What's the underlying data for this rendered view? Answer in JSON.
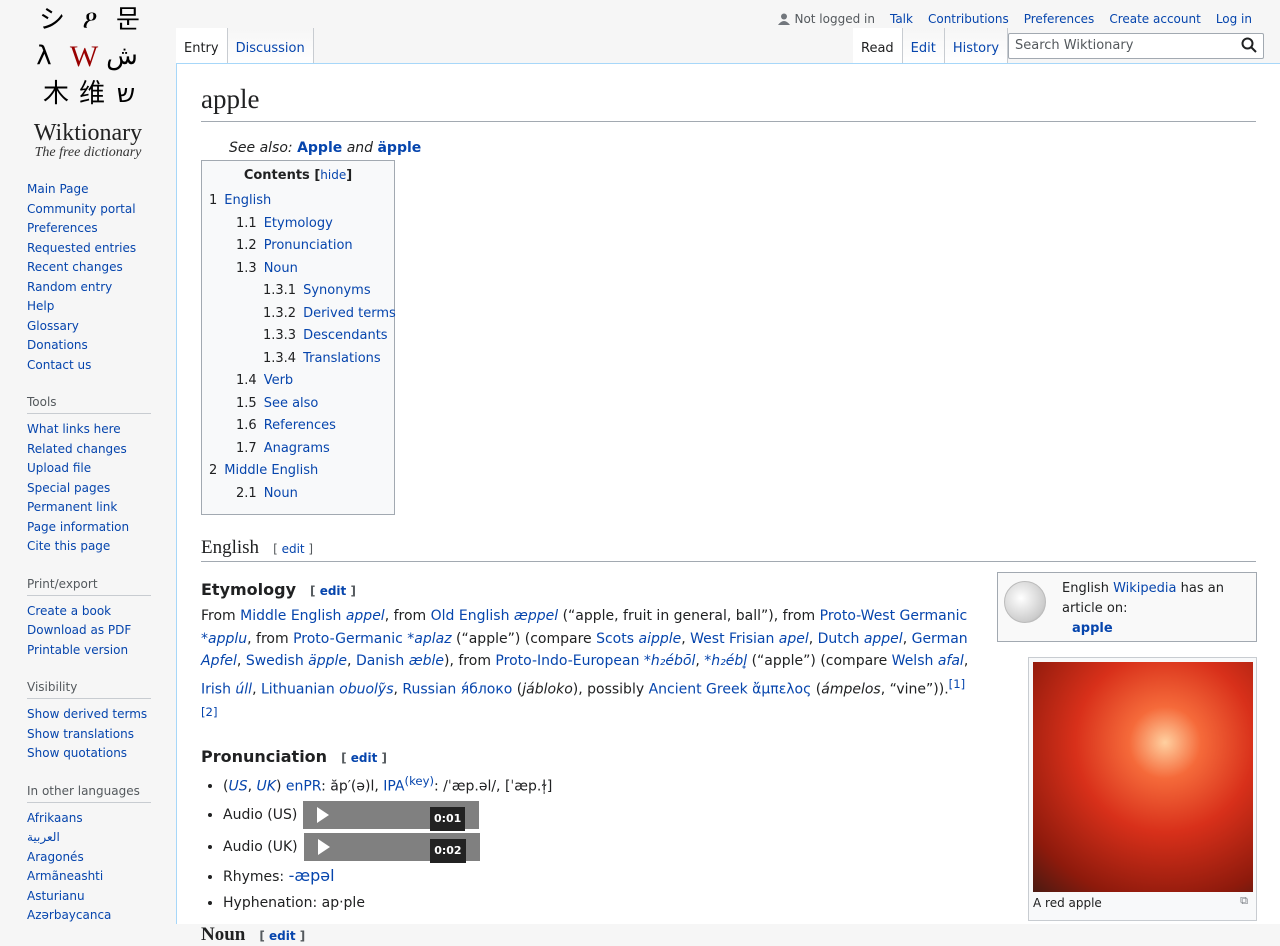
{
  "site": {
    "name": "Wiktionary",
    "tagline": "The free dictionary",
    "logo_glyphs": [
      "シ",
      "ዖ",
      "문",
      "λ",
      "W",
      "ش",
      "木",
      "维",
      "ש"
    ]
  },
  "nav": {
    "main": [
      "Main Page",
      "Community portal",
      "Preferences",
      "Requested entries",
      "Recent changes",
      "Random entry",
      "Help",
      "Glossary",
      "Donations",
      "Contact us"
    ],
    "tools_title": "Tools",
    "tools": [
      "What links here",
      "Related changes",
      "Upload file",
      "Special pages",
      "Permanent link",
      "Page information",
      "Cite this page"
    ],
    "print_title": "Print/export",
    "print": [
      "Create a book",
      "Download as PDF",
      "Printable version"
    ],
    "visibility_title": "Visibility",
    "visibility": [
      "Show derived terms",
      "Show translations",
      "Show quotations"
    ],
    "languages_title": "In other languages",
    "languages": [
      "Afrikaans",
      "العربية",
      "Aragonés",
      "Armãneashti",
      "Asturianu",
      "Azərbaycanca"
    ]
  },
  "personal": {
    "not_logged_in": "Not logged in",
    "talk": "Talk",
    "contributions": "Contributions",
    "preferences": "Preferences",
    "create_account": "Create account",
    "log_in": "Log in"
  },
  "tabs": {
    "entry": "Entry",
    "discussion": "Discussion",
    "read": "Read",
    "edit": "Edit",
    "history": "History"
  },
  "search": {
    "placeholder": "Search Wiktionary"
  },
  "page": {
    "title": "apple",
    "see_also": {
      "prefix": "See also:",
      "a": "Apple",
      "and": "and",
      "b": "äpple"
    },
    "toc": {
      "title": "Contents",
      "hide": "hide",
      "rows": [
        {
          "n": "1",
          "t": "English",
          "lvl": 0
        },
        {
          "n": "1.1",
          "t": "Etymology",
          "lvl": 1
        },
        {
          "n": "1.2",
          "t": "Pronunciation",
          "lvl": 1
        },
        {
          "n": "1.3",
          "t": "Noun",
          "lvl": 1
        },
        {
          "n": "1.3.1",
          "t": "Synonyms",
          "lvl": 2
        },
        {
          "n": "1.3.2",
          "t": "Derived terms",
          "lvl": 2
        },
        {
          "n": "1.3.3",
          "t": "Descendants",
          "lvl": 2
        },
        {
          "n": "1.3.4",
          "t": "Translations",
          "lvl": 2
        },
        {
          "n": "1.4",
          "t": "Verb",
          "lvl": 1
        },
        {
          "n": "1.5",
          "t": "See also",
          "lvl": 1
        },
        {
          "n": "1.6",
          "t": "References",
          "lvl": 1
        },
        {
          "n": "1.7",
          "t": "Anagrams",
          "lvl": 1
        },
        {
          "n": "2",
          "t": "Middle English",
          "lvl": 0
        },
        {
          "n": "2.1",
          "t": "Noun",
          "lvl": 1
        }
      ]
    },
    "h_english": "English",
    "edit_label": "edit",
    "h_etymology": "Etymology",
    "etymology_html": "From <a>Middle English</a> <a><i>appel</i></a>, from <a>Old English</a> <a><i>æppel</i></a> (“apple, fruit in general, ball”), from <a>Proto-West Germanic</a> <a><i>*applu</i></a>, from <a>Proto-Germanic</a> <a><i>*aplaz</i></a> (“apple”) (compare <a>Scots</a> <a><i>aipple</i></a>, <a>West Frisian</a> <a><i>apel</i></a>, <a>Dutch</a> <a><i>appel</i></a>, <a>German</a> <a><i>Apfel</i></a>, <a>Swedish</a> <a><i>äpple</i></a>, <a>Danish</a> <a><i>æble</i></a>), from <a>Proto-Indo-European</a> <a><i>*h₂ébōl</i></a>, <a><i>*h₂ébl̥</i></a> (“apple”) (compare <a>Welsh</a> <a><i>afal</i></a>, <a>Irish</a> <a><i>úll</i></a>, <a>Lithuanian</a> <a><i>obuolỹs</i></a>, <a>Russian</a> <a>я́блоко</a> (<i>jábloko</i>), possibly <a>Ancient Greek</a> <a>ἄμπελος</a> (<i>ámpelos</i>, “vine”)).<sup><a>[1]</a><a>[2]</a></sup>",
    "h_pronunciation": "Pronunciation",
    "pron_line_html": "(<a><i>US</i></a>, <a><i>UK</i></a>) <a>enPR</a>: ăp′(ə)l, <a>IPA</a><sup><a>(key)</a></sup>: /ˈæp.əl/, [ˈæp.ɫ̩]",
    "audio_us": "Audio (US)",
    "audio_us_time": "0:01",
    "audio_uk": "Audio (UK)",
    "audio_uk_time": "0:02",
    "rhymes_label": "Rhymes:",
    "rhymes": "-æpəl",
    "hyphenation": "Hyphenation: ap‧ple",
    "h_noun": "Noun",
    "wikipedia": {
      "pre": "English",
      "link": "Wikipedia",
      "post": "has an article on:",
      "article": "apple"
    },
    "thumb_caption": "A red apple"
  }
}
